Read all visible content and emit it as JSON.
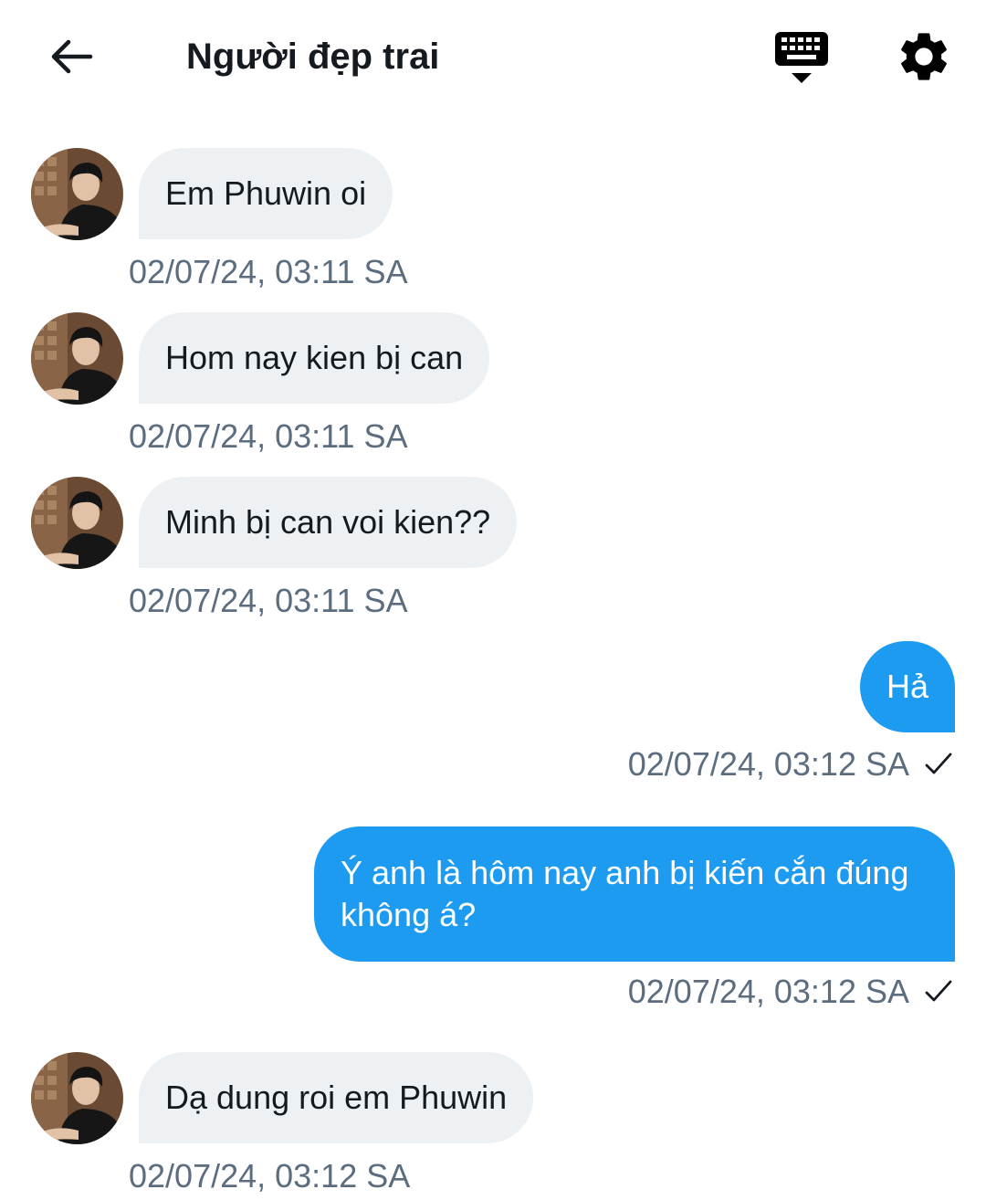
{
  "header": {
    "title": "Người đẹp trai",
    "back_icon": "arrow-left-icon",
    "keyboard_icon": "keyboard-hide-icon",
    "settings_icon": "gear-icon"
  },
  "colors": {
    "outgoing_bubble": "#1d9bf0",
    "incoming_bubble": "#eef1f4",
    "timestamp": "#5b6d7f"
  },
  "messages": [
    {
      "direction": "incoming",
      "text": "Em Phuwin oi",
      "time": "02/07/24, 03:11 SA"
    },
    {
      "direction": "incoming",
      "text": "Hom nay kien bị can",
      "time": "02/07/24, 03:11 SA"
    },
    {
      "direction": "incoming",
      "text": "Minh bị can voi kien??",
      "time": "02/07/24, 03:11 SA"
    },
    {
      "direction": "outgoing",
      "text": "Hả",
      "time": "02/07/24, 03:12 SA",
      "status": "sent"
    },
    {
      "direction": "outgoing",
      "text": "Ý anh là hôm nay anh bị kiến cắn đúng không á?",
      "time": "02/07/24, 03:12 SA",
      "status": "sent"
    },
    {
      "direction": "incoming",
      "text": "Dạ dung roi em Phuwin",
      "time": "02/07/24, 03:12 SA"
    }
  ]
}
